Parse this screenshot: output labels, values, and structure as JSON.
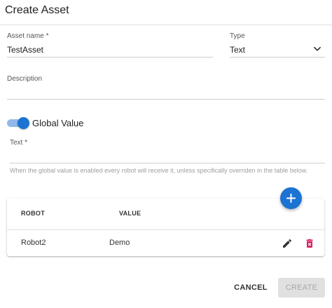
{
  "dialog": {
    "title": "Create Asset"
  },
  "form": {
    "asset_name": {
      "label": "Asset name *",
      "value": "TestAsset"
    },
    "type": {
      "label": "Type",
      "value": "Text"
    },
    "description": {
      "label": "Description",
      "value": ""
    },
    "global_value": {
      "label": "Global Value",
      "enabled": true
    },
    "text": {
      "label": "Text *",
      "value": ""
    },
    "helper_text": "When the global value is enabled every robot will receive it, unless specifically overriden in the table below."
  },
  "table": {
    "columns": [
      "ROBOT",
      "VALUE"
    ],
    "rows": [
      {
        "robot": "Robot2",
        "value": "Demo"
      }
    ]
  },
  "actions": {
    "cancel_label": "CANCEL",
    "create_label": "CREATE"
  },
  "colors": {
    "primary": "#1b73d3",
    "delete": "#d81b60",
    "disabled_bg": "#e0e0e0"
  },
  "icons": {
    "type_dropdown": "chevron-down-icon",
    "add": "plus-icon",
    "edit": "pencil-icon",
    "delete": "trash-icon"
  }
}
